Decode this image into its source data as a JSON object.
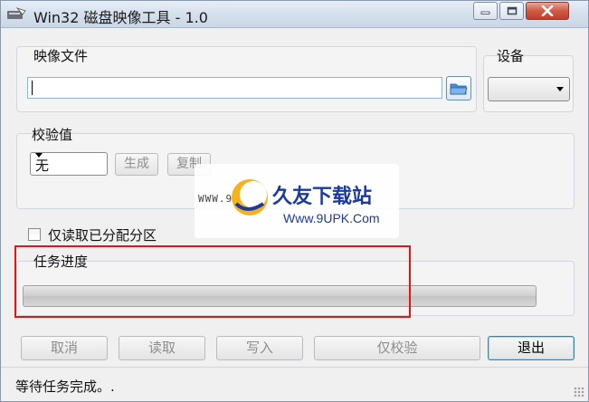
{
  "window": {
    "title": "Win32 磁盘映像工具 - 1.0"
  },
  "image_file": {
    "label": "映像文件",
    "path_value": ""
  },
  "device": {
    "label": "设备",
    "selected": ""
  },
  "hash": {
    "label": "校验值",
    "selected": "无",
    "generate_label": "生成",
    "copy_label": "复制"
  },
  "read_only_allocated": {
    "label": "仅读取已分配分区",
    "checked": false
  },
  "progress": {
    "label": "任务进度",
    "value": 0
  },
  "actions": {
    "cancel": "取消",
    "read": "读取",
    "write": "写入",
    "verify_only": "仅校验",
    "exit": "退出"
  },
  "status": {
    "text": "等待任务完成。."
  },
  "watermark": {
    "url_left": "WWW.9U",
    "site_name": "久友下载站",
    "site_url": "Www.9UPK.Com"
  },
  "colors": {
    "highlight_box": "#e41414",
    "progress_fill": "#c8c8c8",
    "close_button": "#c94a35"
  },
  "icons": {
    "app": "disk-imager-icon",
    "browse": "folder-icon",
    "min": "minimize-icon",
    "max": "maximize-icon",
    "close": "close-icon"
  }
}
